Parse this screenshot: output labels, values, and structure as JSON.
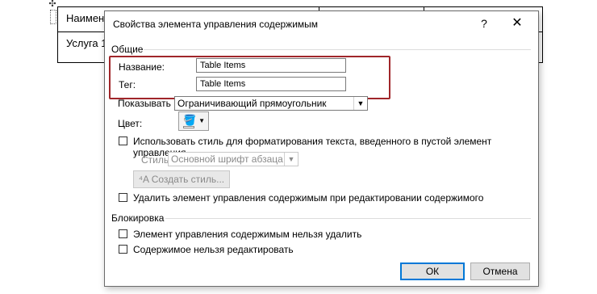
{
  "document": {
    "cell_header": "Наимен",
    "cell_service": "Услуга 1"
  },
  "dialog": {
    "title": "Свойства элемента управления содержимым",
    "help_glyph": "?",
    "close_glyph": "✕",
    "general": {
      "group_label": "Общие",
      "name_label": "Название:",
      "name_value": "Table Items",
      "tag_label": "Тег:",
      "tag_value": "Table Items",
      "show_as_label": "Показывать как:",
      "show_as_value": "Ограничивающий прямоугольник",
      "color_label": "Цвет:",
      "use_style_label": "Использовать стиль для форматирования текста, введенного в пустой элемент управления",
      "style_label": "Стиль:",
      "style_value": "Основной шрифт абзаца",
      "new_style_button": "Создать стиль...",
      "remove_when_edited_label": "Удалить элемент управления содержимым при редактировании содержимого"
    },
    "locking": {
      "group_label": "Блокировка",
      "cannot_delete_label": "Элемент управления содержимым нельзя удалить",
      "cannot_edit_label": "Содержимое нельзя редактировать"
    },
    "ok_button": "ОК",
    "cancel_button": "Отмена"
  },
  "colors": {
    "highlight_frame": "#a0262a",
    "primary_button_border": "#0078d7"
  }
}
